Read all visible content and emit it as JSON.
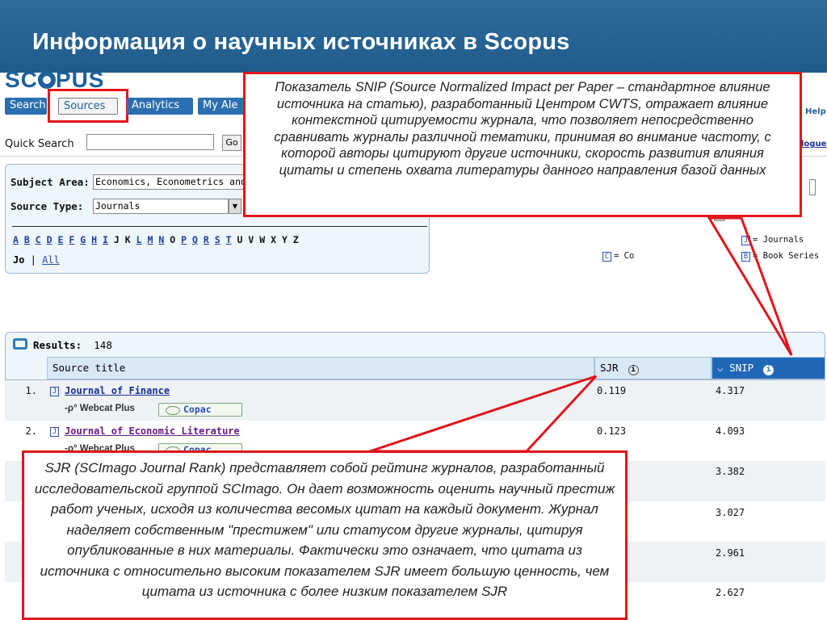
{
  "slide": {
    "title": "Информация о научных источниках в Scopus"
  },
  "logo": {
    "text_before": "SC",
    "text_after": "PUS"
  },
  "nav": {
    "search_label": "Search",
    "sources_label": "Sources",
    "analytics_label": "Analytics",
    "my_alerts_label": "My Ale",
    "help_label": "Help"
  },
  "quick_search": {
    "label": "Quick Search",
    "value": "",
    "go_label": "Go",
    "catalogue_label": "logue"
  },
  "filters": {
    "subject_area_label": "Subject Area:",
    "subject_area_value": "Economics, Econometrics and",
    "source_type_label": "Source Type:",
    "source_type_value": "Journals",
    "letters": [
      "A",
      "B",
      "C",
      "D",
      "E",
      "F",
      "G",
      "H",
      "I",
      "J",
      "K",
      "L",
      "M",
      "N",
      "O",
      "P",
      "Q",
      "R",
      "S",
      "T",
      "U",
      "V",
      "W",
      "X",
      "Y",
      "Z"
    ],
    "linked_letters": [
      "A",
      "B",
      "C",
      "D",
      "E",
      "F",
      "G",
      "H",
      "I",
      "L",
      "M",
      "N",
      "P",
      "Q",
      "R",
      "S",
      "T"
    ],
    "current_prefix": "Jo",
    "all_label": "All"
  },
  "legend": {
    "journals_icon": "J",
    "journals_label": "= Journals",
    "book_series_icon": "B",
    "book_series_label": "= Book Series",
    "conf_icon": "C",
    "conf_label": "= Co"
  },
  "results": {
    "label": "Results:",
    "count": "148",
    "columns": {
      "title": "Source title",
      "sjr": "SJR",
      "snip": "SNIP"
    },
    "rows": [
      {
        "num": "1.",
        "type": "J",
        "title": "Journal of Finance",
        "sjr": "0.119",
        "snip": "4.317",
        "webcat": "Webcat Plus",
        "copac": "Copac"
      },
      {
        "num": "2.",
        "type": "J",
        "title": "Journal of Economic Literature",
        "sjr": "0.123",
        "snip": "4.093",
        "webcat": "Webcat Plus",
        "copac": "Copac"
      },
      {
        "snip": "3.382"
      },
      {
        "snip": "3.027"
      },
      {
        "snip": "2.961"
      },
      {
        "snip": "2.627"
      }
    ]
  },
  "callouts": {
    "snip": "Показатель SNIP (Source Normalized Impact per Paper – стандартное влияние источника на статью), разработанный Центром CWTS, отражает влияние контекстной цитируемости журнала, что позволяет непосредственно сравнивать журналы различной тематики, принимая во внимание частоту, с которой авторы цитируют другие источники, скорость развития влияния цитаты и степень охвата литературы данного направления базой данных",
    "sjr": "SJR (SCImago Journal Rank) представляет собой рейтинг журналов, разработанный исследовательской группой SCImago. Он дает возможность оценить научный престиж работ ученых, исходя из количества весомых цитат на каждый документ. Журнал наделяет собственным \"престижем\" или статусом другие журналы, цитируя опубликованные в них материалы. Фактически это означает, что цитата из источника с относительно высоким показателем SJR имеет большую ценность, чем цитата из источника с более низким показателем SJR"
  },
  "colors": {
    "accent": "#1f68b8",
    "highlight": "#e0161b",
    "title_bar": "#1f5a8a"
  }
}
